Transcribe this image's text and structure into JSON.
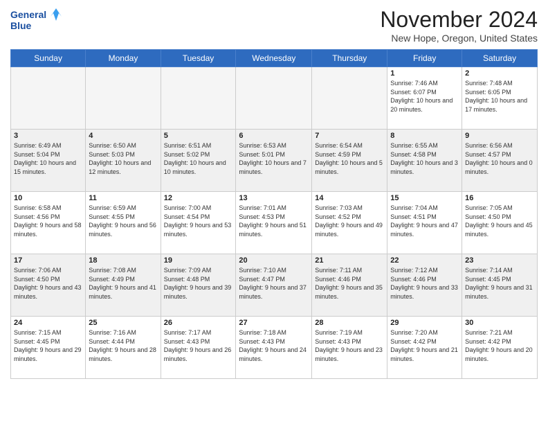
{
  "header": {
    "logo_line1": "General",
    "logo_line2": "Blue",
    "month_title": "November 2024",
    "location": "New Hope, Oregon, United States"
  },
  "days_of_week": [
    "Sunday",
    "Monday",
    "Tuesday",
    "Wednesday",
    "Thursday",
    "Friday",
    "Saturday"
  ],
  "weeks": [
    [
      {
        "day": "",
        "content": ""
      },
      {
        "day": "",
        "content": ""
      },
      {
        "day": "",
        "content": ""
      },
      {
        "day": "",
        "content": ""
      },
      {
        "day": "",
        "content": ""
      },
      {
        "day": "1",
        "content": "Sunrise: 7:46 AM\nSunset: 6:07 PM\nDaylight: 10 hours and 20 minutes."
      },
      {
        "day": "2",
        "content": "Sunrise: 7:48 AM\nSunset: 6:05 PM\nDaylight: 10 hours and 17 minutes."
      }
    ],
    [
      {
        "day": "3",
        "content": "Sunrise: 6:49 AM\nSunset: 5:04 PM\nDaylight: 10 hours and 15 minutes."
      },
      {
        "day": "4",
        "content": "Sunrise: 6:50 AM\nSunset: 5:03 PM\nDaylight: 10 hours and 12 minutes."
      },
      {
        "day": "5",
        "content": "Sunrise: 6:51 AM\nSunset: 5:02 PM\nDaylight: 10 hours and 10 minutes."
      },
      {
        "day": "6",
        "content": "Sunrise: 6:53 AM\nSunset: 5:01 PM\nDaylight: 10 hours and 7 minutes."
      },
      {
        "day": "7",
        "content": "Sunrise: 6:54 AM\nSunset: 4:59 PM\nDaylight: 10 hours and 5 minutes."
      },
      {
        "day": "8",
        "content": "Sunrise: 6:55 AM\nSunset: 4:58 PM\nDaylight: 10 hours and 3 minutes."
      },
      {
        "day": "9",
        "content": "Sunrise: 6:56 AM\nSunset: 4:57 PM\nDaylight: 10 hours and 0 minutes."
      }
    ],
    [
      {
        "day": "10",
        "content": "Sunrise: 6:58 AM\nSunset: 4:56 PM\nDaylight: 9 hours and 58 minutes."
      },
      {
        "day": "11",
        "content": "Sunrise: 6:59 AM\nSunset: 4:55 PM\nDaylight: 9 hours and 56 minutes."
      },
      {
        "day": "12",
        "content": "Sunrise: 7:00 AM\nSunset: 4:54 PM\nDaylight: 9 hours and 53 minutes."
      },
      {
        "day": "13",
        "content": "Sunrise: 7:01 AM\nSunset: 4:53 PM\nDaylight: 9 hours and 51 minutes."
      },
      {
        "day": "14",
        "content": "Sunrise: 7:03 AM\nSunset: 4:52 PM\nDaylight: 9 hours and 49 minutes."
      },
      {
        "day": "15",
        "content": "Sunrise: 7:04 AM\nSunset: 4:51 PM\nDaylight: 9 hours and 47 minutes."
      },
      {
        "day": "16",
        "content": "Sunrise: 7:05 AM\nSunset: 4:50 PM\nDaylight: 9 hours and 45 minutes."
      }
    ],
    [
      {
        "day": "17",
        "content": "Sunrise: 7:06 AM\nSunset: 4:50 PM\nDaylight: 9 hours and 43 minutes."
      },
      {
        "day": "18",
        "content": "Sunrise: 7:08 AM\nSunset: 4:49 PM\nDaylight: 9 hours and 41 minutes."
      },
      {
        "day": "19",
        "content": "Sunrise: 7:09 AM\nSunset: 4:48 PM\nDaylight: 9 hours and 39 minutes."
      },
      {
        "day": "20",
        "content": "Sunrise: 7:10 AM\nSunset: 4:47 PM\nDaylight: 9 hours and 37 minutes."
      },
      {
        "day": "21",
        "content": "Sunrise: 7:11 AM\nSunset: 4:46 PM\nDaylight: 9 hours and 35 minutes."
      },
      {
        "day": "22",
        "content": "Sunrise: 7:12 AM\nSunset: 4:46 PM\nDaylight: 9 hours and 33 minutes."
      },
      {
        "day": "23",
        "content": "Sunrise: 7:14 AM\nSunset: 4:45 PM\nDaylight: 9 hours and 31 minutes."
      }
    ],
    [
      {
        "day": "24",
        "content": "Sunrise: 7:15 AM\nSunset: 4:45 PM\nDaylight: 9 hours and 29 minutes."
      },
      {
        "day": "25",
        "content": "Sunrise: 7:16 AM\nSunset: 4:44 PM\nDaylight: 9 hours and 28 minutes."
      },
      {
        "day": "26",
        "content": "Sunrise: 7:17 AM\nSunset: 4:43 PM\nDaylight: 9 hours and 26 minutes."
      },
      {
        "day": "27",
        "content": "Sunrise: 7:18 AM\nSunset: 4:43 PM\nDaylight: 9 hours and 24 minutes."
      },
      {
        "day": "28",
        "content": "Sunrise: 7:19 AM\nSunset: 4:43 PM\nDaylight: 9 hours and 23 minutes."
      },
      {
        "day": "29",
        "content": "Sunrise: 7:20 AM\nSunset: 4:42 PM\nDaylight: 9 hours and 21 minutes."
      },
      {
        "day": "30",
        "content": "Sunrise: 7:21 AM\nSunset: 4:42 PM\nDaylight: 9 hours and 20 minutes."
      }
    ]
  ]
}
